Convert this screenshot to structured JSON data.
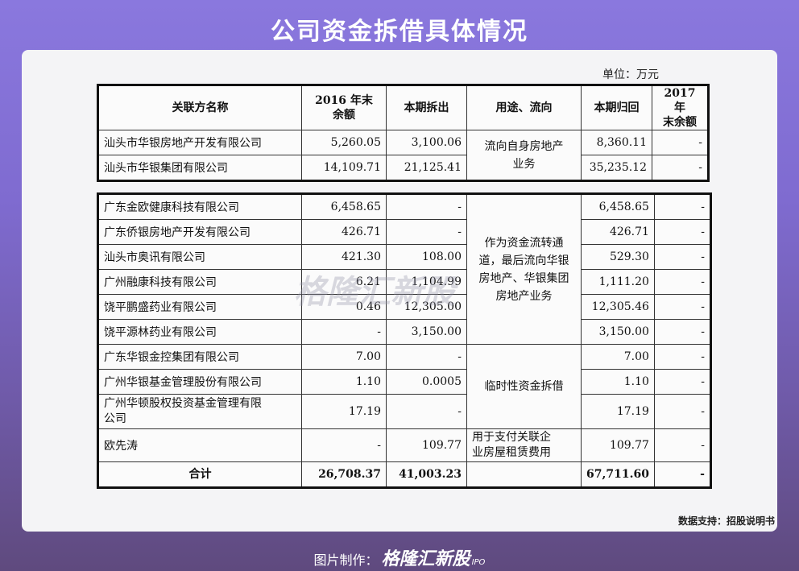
{
  "title": "公司资金拆借具体情况",
  "unit": "单位：万元",
  "headers": [
    "关联方名称",
    "2016 年末\n余额",
    "本期拆出",
    "用途、流向",
    "本期归回",
    "2017 年\n末余额"
  ],
  "group1": {
    "rows": [
      {
        "name": "汕头市华银房地产开发有限公司",
        "bal2016": "5,260.05",
        "out": "3,100.06",
        "back": "8,360.11",
        "bal2017": "-"
      },
      {
        "name": "汕头市华银集团有限公司",
        "bal2016": "14,109.71",
        "out": "21,125.41",
        "back": "35,235.12",
        "bal2017": "-"
      }
    ],
    "usage": "流向自身房地产\n业务"
  },
  "group2": {
    "rows": [
      {
        "name": "广东金欧健康科技有限公司",
        "bal2016": "6,458.65",
        "out": "-",
        "back": "6,458.65",
        "bal2017": "-"
      },
      {
        "name": "广东侨银房地产开发有限公司",
        "bal2016": "426.71",
        "out": "-",
        "back": "426.71",
        "bal2017": "-"
      },
      {
        "name": "汕头市奥讯有限公司",
        "bal2016": "421.30",
        "out": "108.00",
        "back": "529.30",
        "bal2017": "-"
      },
      {
        "name": "广州融康科技有限公司",
        "bal2016": "6.21",
        "out": "1,104.99",
        "back": "1,111.20",
        "bal2017": "-"
      },
      {
        "name": "饶平鹏盛药业有限公司",
        "bal2016": "0.46",
        "out": "12,305.00",
        "back": "12,305.46",
        "bal2017": "-"
      },
      {
        "name": "饶平源林药业有限公司",
        "bal2016": "-",
        "out": "3,150.00",
        "back": "3,150.00",
        "bal2017": "-"
      }
    ],
    "usage": "作为资金流转通\n道，最后流向华银\n房地产、华银集团\n房地产业务"
  },
  "group3": {
    "rows": [
      {
        "name": "广东华银金控集团有限公司",
        "bal2016": "7.00",
        "out": "-",
        "back": "7.00",
        "bal2017": "-"
      },
      {
        "name": "广州华银基金管理股份有限公司",
        "bal2016": "1.10",
        "out": "0.0005",
        "back": "1.10",
        "bal2017": "-"
      },
      {
        "name": "广州华顿股权投资基金管理有限\n公司",
        "bal2016": "17.19",
        "out": "-",
        "back": "17.19",
        "bal2017": "-"
      }
    ],
    "usage": "临时性资金拆借"
  },
  "group4": {
    "row": {
      "name": "欧先涛",
      "bal2016": "-",
      "out": "109.77",
      "back": "109.77",
      "bal2017": "-"
    },
    "usage": "用于支付关联企\n业房屋租赁费用"
  },
  "total": {
    "name": "合计",
    "bal2016": "26,708.37",
    "out": "41,003.23",
    "usage": "",
    "back": "67,711.60",
    "bal2017": "-"
  },
  "watermark": "格隆汇新股",
  "source": "数据支持：招股说明书",
  "footer": {
    "label": "图片制作：",
    "brand": "格隆汇新股",
    "ipo": "IPO"
  }
}
